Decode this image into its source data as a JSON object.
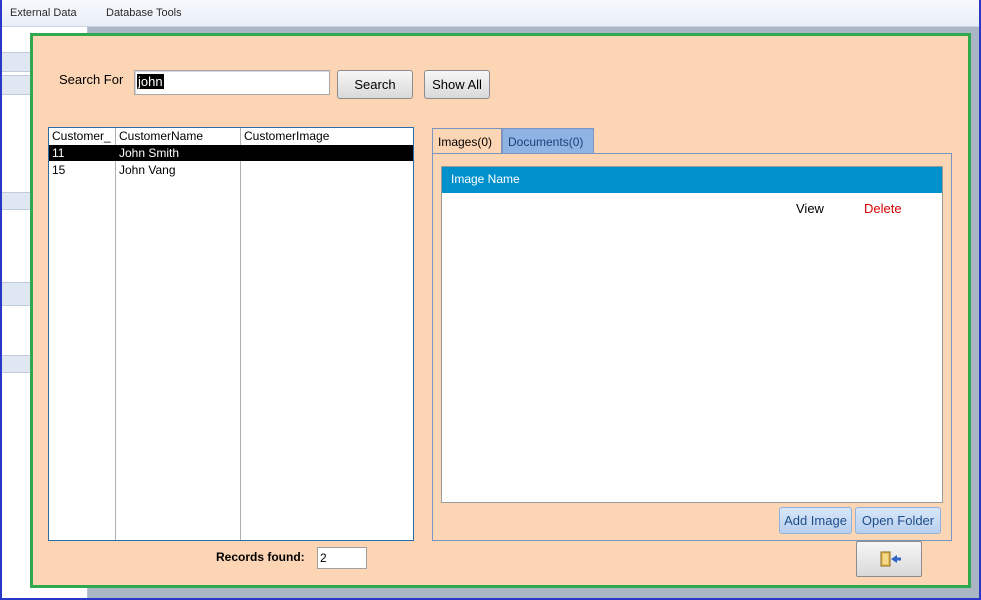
{
  "ribbon": {
    "tabs": [
      "External Data",
      "Database Tools"
    ]
  },
  "form": {
    "search_label": "Search For",
    "search_value": "john",
    "search_button": "Search",
    "show_all_button": "Show All",
    "list": {
      "columns": [
        "Customer_",
        "CustomerName",
        "CustomerImage"
      ],
      "rows": [
        {
          "id": "11",
          "name": "John Smith",
          "image": "",
          "selected": true
        },
        {
          "id": "15",
          "name": "John Vang",
          "image": "",
          "selected": false
        }
      ]
    },
    "records_found_label": "Records found:",
    "records_found_value": "2",
    "tabs": [
      "Images(0)",
      "Documents(0)"
    ],
    "images": {
      "header": "Image Name",
      "view_label": "View",
      "delete_label": "Delete",
      "add_button": "Add Image",
      "open_folder_button": "Open Folder"
    },
    "exit_icon": "exit-door-icon"
  },
  "colors": {
    "form_background": "#fcd5b4",
    "form_border": "#2fa84f",
    "subform_header": "#0090cc",
    "delete_text": "#d40000",
    "inactive_tab": "#8fb4e3"
  }
}
